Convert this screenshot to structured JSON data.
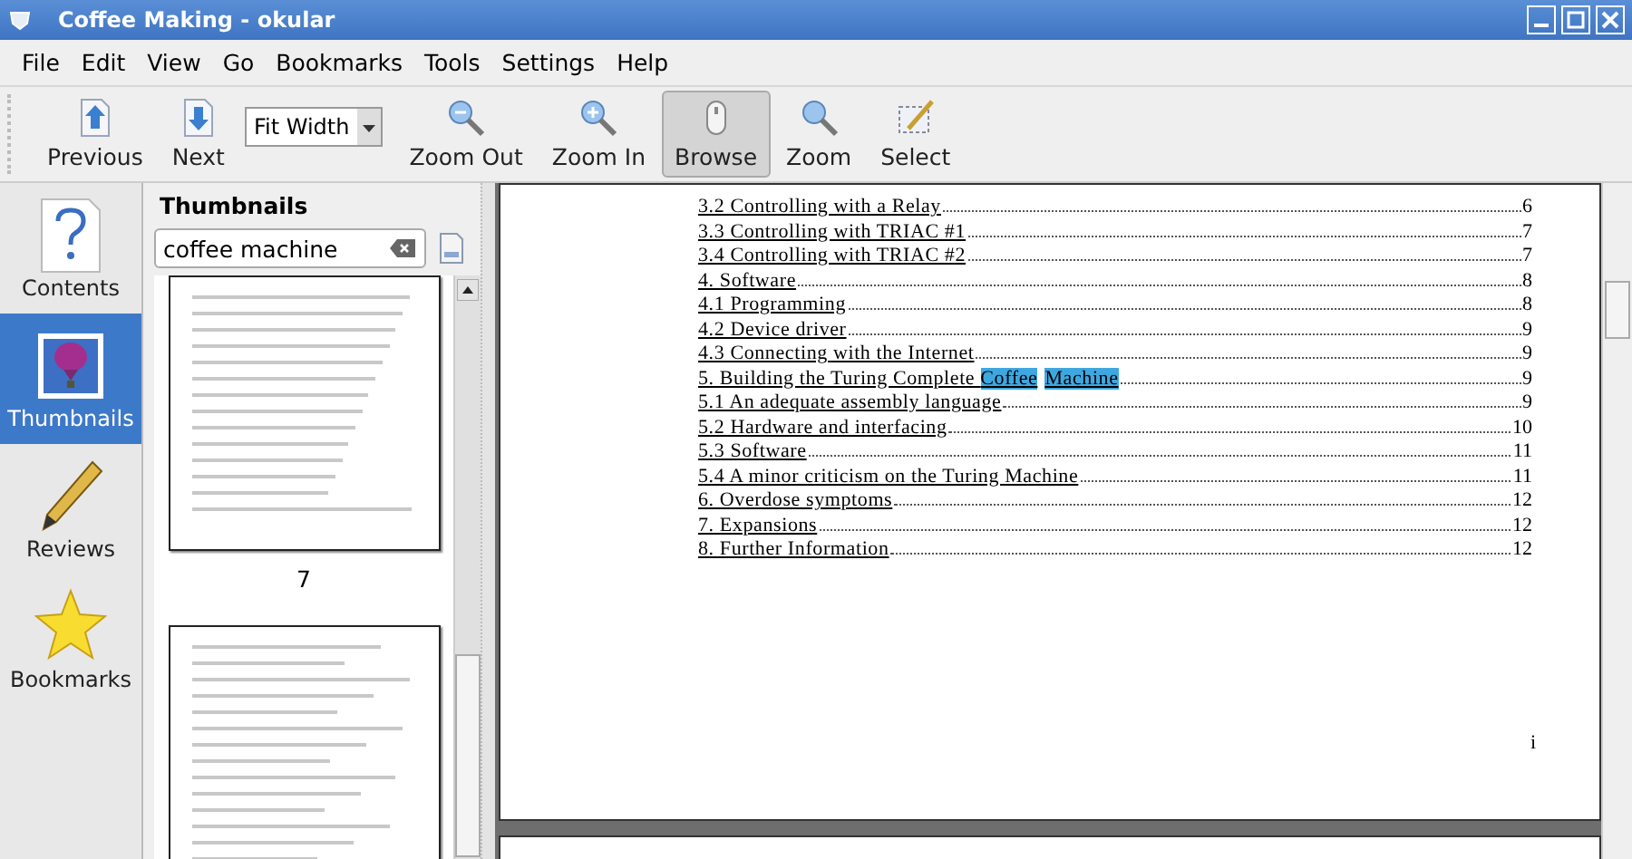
{
  "window": {
    "title": "Coffee Making - okular"
  },
  "menu": [
    "File",
    "Edit",
    "View",
    "Go",
    "Bookmarks",
    "Tools",
    "Settings",
    "Help"
  ],
  "toolbar": [
    {
      "kind": "button",
      "label": "Previous",
      "selected": false
    },
    {
      "kind": "button",
      "label": "Next",
      "selected": false
    },
    {
      "kind": "combo",
      "value": "Fit Width"
    },
    {
      "kind": "button",
      "label": "Zoom Out",
      "selected": false
    },
    {
      "kind": "button",
      "label": "Zoom In",
      "selected": false
    },
    {
      "kind": "button",
      "label": "Browse",
      "selected": true
    },
    {
      "kind": "button",
      "label": "Zoom",
      "selected": false
    },
    {
      "kind": "button",
      "label": "Select",
      "selected": false
    }
  ],
  "sidebar": {
    "items": [
      {
        "label": "Contents",
        "selected": false
      },
      {
        "label": "Thumbnails",
        "selected": true
      },
      {
        "label": "Reviews",
        "selected": false
      },
      {
        "label": "Bookmarks",
        "selected": false
      }
    ]
  },
  "panel": {
    "title": "Thumbnails",
    "search": {
      "value": "coffee machine"
    },
    "thumbnails": [
      {
        "page": "7"
      }
    ]
  },
  "document": {
    "toc": [
      {
        "parts": [
          {
            "text": "3.2 Controlling with a Relay",
            "match": false
          }
        ],
        "page": "6"
      },
      {
        "parts": [
          {
            "text": "3.3 Controlling with TRIAC #1",
            "match": false
          }
        ],
        "page": "7"
      },
      {
        "parts": [
          {
            "text": "3.4 Controlling with TRIAC #2",
            "match": false
          }
        ],
        "page": "7"
      },
      {
        "parts": [
          {
            "text": "4. Software",
            "match": false
          }
        ],
        "page": "8"
      },
      {
        "parts": [
          {
            "text": "4.1 Programming",
            "match": false
          }
        ],
        "page": "8"
      },
      {
        "parts": [
          {
            "text": "4.2 Device driver",
            "match": false
          }
        ],
        "page": "9"
      },
      {
        "parts": [
          {
            "text": "4.3 Connecting with the Internet",
            "match": false
          }
        ],
        "page": "9"
      },
      {
        "parts": [
          {
            "text": "5. Building the Turing Complete ",
            "match": false
          },
          {
            "text": "Coffee",
            "match": true
          },
          {
            "text": "Machine",
            "match": true
          }
        ],
        "page": "9"
      },
      {
        "parts": [
          {
            "text": "5.1 An adequate assembly language",
            "match": false
          }
        ],
        "page": "9"
      },
      {
        "parts": [
          {
            "text": "5.2 Hardware and interfacing",
            "match": false
          }
        ],
        "page": "10"
      },
      {
        "parts": [
          {
            "text": "5.3 Software",
            "match": false
          }
        ],
        "page": "11"
      },
      {
        "parts": [
          {
            "text": "5.4 A minor criticism on the Turing Machine",
            "match": false
          }
        ],
        "page": "11"
      },
      {
        "parts": [
          {
            "text": "6. Overdose symptoms",
            "match": false
          }
        ],
        "page": "12"
      },
      {
        "parts": [
          {
            "text": "7. Expansions",
            "match": false
          }
        ],
        "page": "12"
      },
      {
        "parts": [
          {
            "text": "8. Further Information",
            "match": false
          }
        ],
        "page": "12"
      }
    ],
    "page_number": "i"
  }
}
